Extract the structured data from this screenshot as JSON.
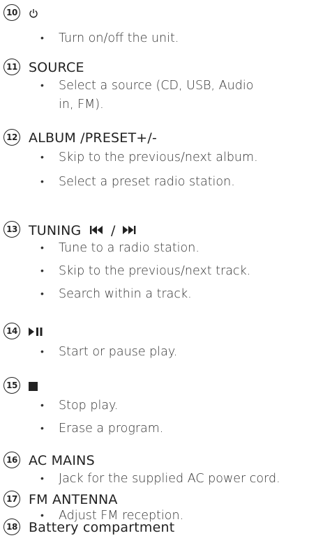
{
  "items": [
    {
      "number": "10",
      "title": "",
      "icon": "power-icon",
      "bullets": [
        "Turn on/off the unit."
      ]
    },
    {
      "number": "11",
      "title": "SOURCE",
      "bullets": [
        "Select a source (CD, USB, Audio in, FM)."
      ]
    },
    {
      "number": "12",
      "title": "ALBUM /PRESET+/-",
      "bullets": [
        "Skip to the previous/next album.",
        "Select a preset radio station."
      ]
    },
    {
      "number": "13",
      "title": "TUNING",
      "icon": "prev-next-icon",
      "title_suffix": "/",
      "bullets": [
        "Tune to a radio station.",
        "Skip to the previous/next track.",
        "Search within a track."
      ]
    },
    {
      "number": "14",
      "title": "",
      "icon": "play-pause-icon",
      "bullets": [
        "Start or pause play."
      ]
    },
    {
      "number": "15",
      "title": "",
      "icon": "stop-icon",
      "bullets": [
        "Stop play.",
        "Erase a program."
      ]
    },
    {
      "number": "16",
      "title": "AC MAINS",
      "bullets": [
        "Jack for the supplied AC power cord."
      ]
    },
    {
      "number": "17",
      "title": "FM ANTENNA",
      "bullets": [
        "Adjust FM reception."
      ]
    },
    {
      "number": "18",
      "title": "Battery compartment",
      "bullets": []
    }
  ]
}
